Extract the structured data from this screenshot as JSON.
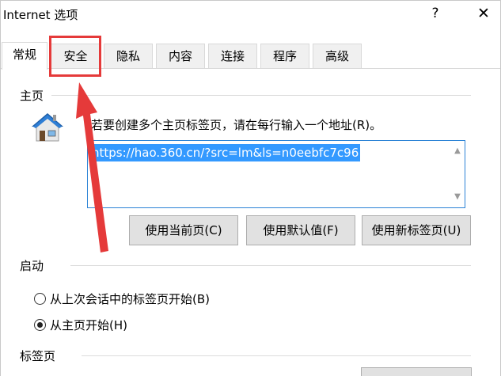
{
  "window": {
    "title": "Internet 选项",
    "help": "?",
    "close": "✕"
  },
  "tabs": [
    {
      "label": "常规",
      "active": true
    },
    {
      "label": "安全",
      "active": false
    },
    {
      "label": "隐私",
      "active": false
    },
    {
      "label": "内容",
      "active": false
    },
    {
      "label": "连接",
      "active": false
    },
    {
      "label": "程序",
      "active": false
    },
    {
      "label": "高级",
      "active": false
    }
  ],
  "home": {
    "section_label": "主页",
    "description": "若要创建多个主页标签页，请在每行输入一个地址(R)。",
    "url": "https://hao.360.cn/?src=lm&ls=n0eebfc7c96",
    "buttons": {
      "use_current": "使用当前页(C)",
      "use_default": "使用默认值(F)",
      "use_new_tab": "使用新标签页(U)"
    }
  },
  "startup": {
    "section_label": "启动",
    "options": [
      {
        "label": "从上次会话中的标签页开始(B)",
        "checked": false
      },
      {
        "label": "从主页开始(H)",
        "checked": true
      }
    ]
  },
  "tabs_section": {
    "section_label": "标签页"
  },
  "colors": {
    "annotation": "#e53a3a",
    "selection": "#3399ff",
    "focus_border": "#2c83d6"
  },
  "icons": {
    "home": "house-icon",
    "close": "close-icon",
    "help": "help-icon"
  }
}
